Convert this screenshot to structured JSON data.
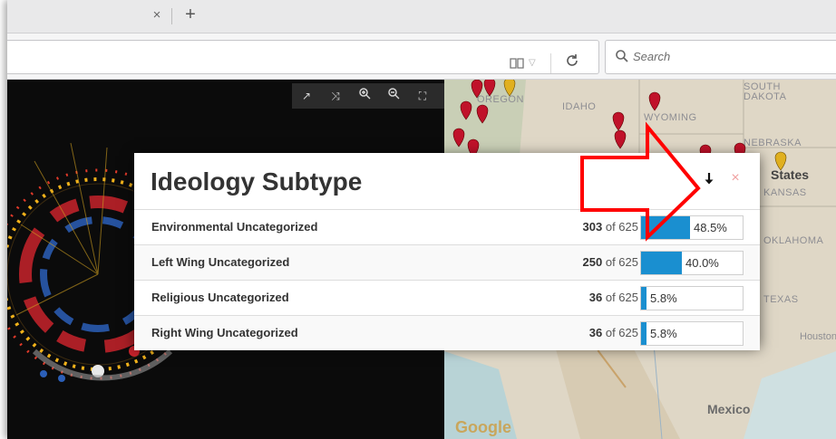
{
  "browser": {
    "tab_close_glyph": "×",
    "new_tab_glyph": "+",
    "reload_glyph": "C",
    "search_placeholder": "Search"
  },
  "viz_toolbar": {
    "tools": [
      "expand-tool",
      "shuffle-tool",
      "zoom-in-tool",
      "zoom-out-tool",
      "fit-tool"
    ]
  },
  "map": {
    "labels": [
      "OREGON",
      "IDAHO",
      "WYOMING",
      "SOUTH",
      "DAKOTA",
      "NEBRASKA",
      "KANSAS",
      "OKLAHOMA",
      "TEXAS",
      "Houston",
      "Mexico",
      "Google",
      "States"
    ]
  },
  "modal": {
    "title": "Ideology Subtype",
    "download_glyph": "🡓",
    "close_glyph": "×",
    "rows": [
      {
        "label": "Environmental Uncategorized",
        "count": "303",
        "of": "of 625",
        "percent": "48.5%",
        "fraction": 0.485
      },
      {
        "label": "Left Wing Uncategorized",
        "count": "250",
        "of": "of 625",
        "percent": "40.0%",
        "fraction": 0.4
      },
      {
        "label": "Religious Uncategorized",
        "count": "36",
        "of": "of 625",
        "percent": "5.8%",
        "fraction": 0.058
      },
      {
        "label": "Right Wing Uncategorized",
        "count": "36",
        "of": "of 625",
        "percent": "5.8%",
        "fraction": 0.058
      }
    ]
  },
  "colors": {
    "bar": "#1a8fd0",
    "annotation_arrow": "#ff0000"
  }
}
